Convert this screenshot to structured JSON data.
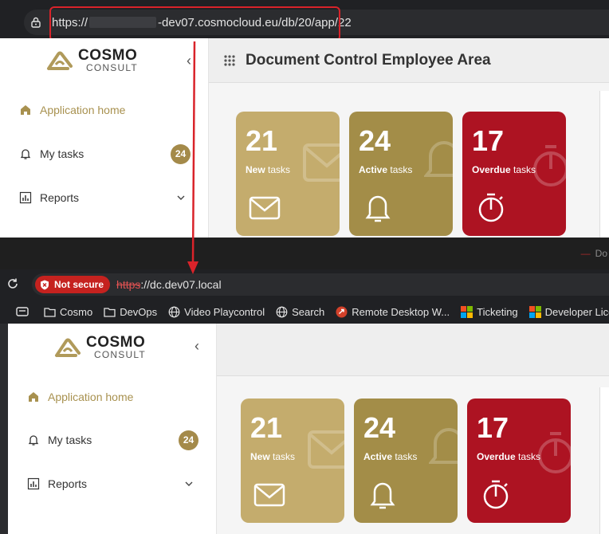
{
  "top": {
    "url": {
      "prefix": "https://",
      "suffix": "-dev07.cosmocloud.eu/db/20/app/22"
    },
    "logo": {
      "word1": "COSMO",
      "word2": "CONSULT"
    },
    "nav": [
      {
        "label": "Application home"
      },
      {
        "label": "My tasks",
        "badge": "24"
      },
      {
        "label": "Reports"
      }
    ],
    "page_title": "Document Control Employee Area",
    "tiles": [
      {
        "count": "21",
        "bold": "New",
        "rest": " tasks"
      },
      {
        "count": "24",
        "bold": "Active",
        "rest": " tasks"
      },
      {
        "count": "17",
        "bold": "Overdue",
        "rest": " tasks"
      }
    ]
  },
  "mid": {
    "tab_fragment": "Do"
  },
  "bottom": {
    "security_label": "Not secure",
    "url": {
      "scheme": "https",
      "rest": "://dc.dev07.local"
    },
    "bookmarks": [
      "Cosmo",
      "DevOps",
      "Video Playcontrol",
      "Search",
      "Remote Desktop W...",
      "Ticketing",
      "Developer Licen"
    ],
    "logo": {
      "word1": "COSMO",
      "word2": "CONSULT"
    },
    "nav": [
      {
        "label": "Application home"
      },
      {
        "label": "My tasks",
        "badge": "24"
      },
      {
        "label": "Reports"
      }
    ],
    "tiles": [
      {
        "count": "21",
        "bold": "New",
        "rest": " tasks"
      },
      {
        "count": "24",
        "bold": "Active",
        "rest": " tasks"
      },
      {
        "count": "17",
        "bold": "Overdue",
        "rest": " tasks"
      }
    ]
  },
  "colors": {
    "accent_gold": "#a8914f",
    "tile_new": "#c4ac6d",
    "tile_active": "#a38d48",
    "tile_overdue": "#ad1322",
    "highlight_red": "#d9232a"
  }
}
